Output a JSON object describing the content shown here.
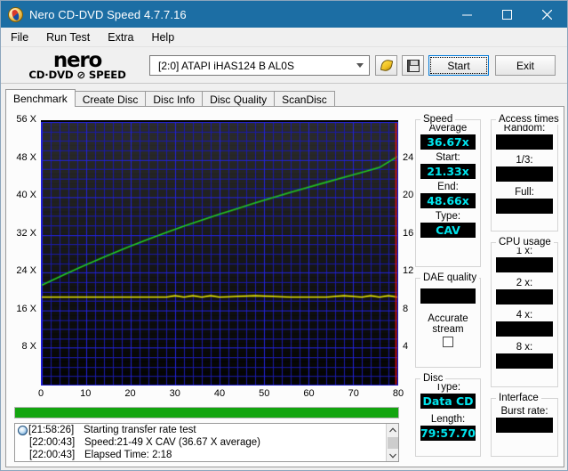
{
  "window": {
    "title": "Nero CD-DVD Speed 4.7.7.16",
    "icon": "nero-disc-icon",
    "minimize": "─",
    "maximize": "☐",
    "close": "✕"
  },
  "menu": [
    {
      "label": "File"
    },
    {
      "label": "Run Test"
    },
    {
      "label": "Extra"
    },
    {
      "label": "Help"
    }
  ],
  "toolbar": {
    "logo_main": "nero",
    "logo_sub": "CD·DVD ⊘ SPEED",
    "device": "[2:0]   ATAPI iHAS124  B AL0S",
    "speed_button": "speed-icon",
    "save_button": "save-icon",
    "start_label": "Start",
    "exit_label": "Exit"
  },
  "tabs": [
    {
      "label": "Benchmark",
      "active": true
    },
    {
      "label": "Create Disc",
      "active": false
    },
    {
      "label": "Disc Info",
      "active": false
    },
    {
      "label": "Disc Quality",
      "active": false
    },
    {
      "label": "ScanDisc",
      "active": false
    }
  ],
  "chart_data": {
    "type": "line",
    "title": "",
    "xlabel": "",
    "ylabel": "",
    "xlim": [
      0,
      80
    ],
    "ylim": [
      0,
      56
    ],
    "y2lim": [
      0,
      28
    ],
    "grid": true,
    "x_ticks": [
      0,
      10,
      20,
      30,
      40,
      50,
      60,
      70,
      80
    ],
    "y_ticks": [
      8,
      16,
      24,
      32,
      40,
      48,
      56
    ],
    "y_tick_labels": [
      "8 X",
      "16 X",
      "24 X",
      "32 X",
      "40 X",
      "48 X",
      "56 X"
    ],
    "y2_ticks": [
      4,
      8,
      12,
      16,
      20,
      24
    ],
    "y2_tick_labels": [
      "4",
      "8",
      "12",
      "16",
      "20",
      "24"
    ],
    "colors": {
      "read_speed": "#22cc22",
      "transfer": "#e8e800",
      "marker": "#ee1111",
      "grid_major": "#2222dd",
      "grid_minor": "#1a1aaa",
      "background": "#000000"
    },
    "series": [
      {
        "name": "Read speed",
        "axis": "left",
        "color": "#22cc22",
        "x": [
          0,
          4,
          8,
          12,
          16,
          20,
          24,
          28,
          32,
          36,
          40,
          44,
          48,
          52,
          56,
          60,
          64,
          68,
          72,
          76,
          80
        ],
        "values": [
          21.33,
          23.1,
          24.85,
          26.5,
          28.1,
          29.65,
          31.1,
          32.5,
          33.85,
          35.15,
          36.4,
          37.6,
          38.8,
          39.95,
          41.05,
          42.15,
          43.2,
          44.25,
          45.3,
          46.35,
          48.66
        ]
      },
      {
        "name": "Transfer rate",
        "axis": "right",
        "color": "#e8e800",
        "x": [
          0,
          4,
          8,
          12,
          16,
          20,
          24,
          28,
          30,
          32,
          34,
          36,
          38,
          40,
          48,
          56,
          64,
          68,
          72,
          74,
          76,
          78,
          80
        ],
        "values": [
          9.4,
          9.4,
          9.4,
          9.4,
          9.4,
          9.4,
          9.4,
          9.4,
          9.55,
          9.4,
          9.55,
          9.4,
          9.55,
          9.4,
          9.55,
          9.4,
          9.4,
          9.55,
          9.4,
          9.55,
          9.4,
          9.55,
          9.4
        ]
      }
    ],
    "vline": {
      "x": 80,
      "color": "#ee1111"
    }
  },
  "progress": {
    "percent": 100,
    "color": "#13a50f"
  },
  "log": {
    "entries": [
      {
        "icon": "info-icon",
        "time": "[21:58:26]",
        "message": "Starting transfer rate test"
      },
      {
        "icon": "",
        "time": "[22:00:43]",
        "message": "Speed:21-49 X CAV (36.67 X average)"
      },
      {
        "icon": "",
        "time": "[22:00:43]",
        "message": "Elapsed Time:  2:18"
      }
    ],
    "scroll_up": "⌃",
    "scroll_down": "⌄"
  },
  "panels": {
    "speed": {
      "title": "Speed",
      "fields": [
        {
          "label": "Average",
          "value": "36.67x"
        },
        {
          "label": "Start:",
          "value": "21.33x"
        },
        {
          "label": "End:",
          "value": "48.66x"
        },
        {
          "label": "Type:",
          "value": "CAV"
        }
      ]
    },
    "dae_quality": {
      "title": "DAE quality",
      "value": "",
      "checkbox_label_line1": "Accurate",
      "checkbox_label_line2": "stream",
      "checked": false
    },
    "disc": {
      "title": "Disc",
      "fields": [
        {
          "label": "Type:",
          "value": "Data CD"
        },
        {
          "label": "Length:",
          "value": "79:57.70"
        }
      ]
    },
    "access_times": {
      "title": "Access times",
      "fields": [
        {
          "label": "Random:",
          "value": ""
        },
        {
          "label": "1/3:",
          "value": ""
        },
        {
          "label": "Full:",
          "value": ""
        }
      ]
    },
    "cpu_usage": {
      "title": "CPU usage",
      "fields": [
        {
          "label": "1 x:",
          "value": ""
        },
        {
          "label": "2 x:",
          "value": ""
        },
        {
          "label": "4 x:",
          "value": ""
        },
        {
          "label": "8 x:",
          "value": ""
        }
      ]
    },
    "interface": {
      "title": "Interface",
      "fields": [
        {
          "label": "Burst rate:",
          "value": ""
        }
      ]
    }
  }
}
